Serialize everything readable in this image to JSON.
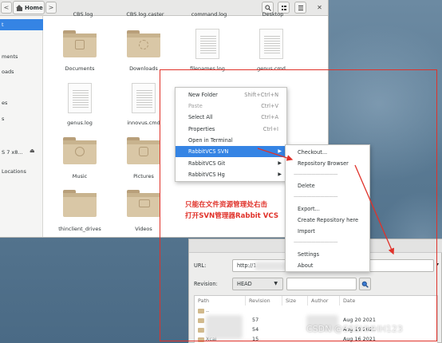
{
  "header": {
    "home_label": "Home",
    "back_glyph": "<",
    "forward_glyph": ">",
    "search_icon": "search-icon",
    "view_icon": "list-view-icon",
    "menu_icon": "hamburger-menu-icon"
  },
  "sidebar": {
    "items": [
      {
        "label": "t",
        "active": true
      },
      {
        "label": "ments"
      },
      {
        "label": "oads"
      },
      {
        "label": "es"
      },
      {
        "label": "s"
      },
      {
        "label": "S 7 x8...",
        "eject": true
      },
      {
        "label": "Locations"
      }
    ]
  },
  "files": {
    "top_row_partial": [
      "CBS.log",
      "CBS.log.caster",
      "command.log",
      "Desktop"
    ],
    "items": [
      {
        "name": "Documents",
        "kind": "folder"
      },
      {
        "name": "Downloads",
        "kind": "folder"
      },
      {
        "name": "filenames.log",
        "kind": "document"
      },
      {
        "name": "genus.cmd",
        "kind": "document"
      },
      {
        "name": "genus.log",
        "kind": "document"
      },
      {
        "name": "innovus.cmd",
        "kind": "document"
      },
      {
        "name": "Music",
        "kind": "folder"
      },
      {
        "name": "Pictures",
        "kind": "folder"
      },
      {
        "name": "thinclient_drives",
        "kind": "folder"
      },
      {
        "name": "Videos",
        "kind": "folder"
      }
    ],
    "partial_suffix": "v"
  },
  "context_menu": {
    "items": [
      {
        "label": "New Folder",
        "accel": "Shift+Ctrl+N"
      },
      {
        "label": "Paste",
        "accel": "Ctrl+V",
        "disabled": true
      },
      {
        "label": "Select All",
        "accel": "Ctrl+A"
      },
      {
        "label": "Properties",
        "accel": "Ctrl+I"
      },
      {
        "label": "Open in Terminal",
        "accel": ""
      },
      {
        "label": "RabbitVCS SVN",
        "accel": "",
        "submenu": true,
        "active": true
      },
      {
        "label": "RabbitVCS Git",
        "accel": "",
        "submenu": true
      },
      {
        "label": "RabbitVCS Hg",
        "accel": "",
        "submenu": true
      }
    ]
  },
  "svn_submenu": {
    "items": [
      "Checkout...",
      "Repository Browser",
      "Delete",
      "Export...",
      "Create Repository here",
      "Import",
      "Settings",
      "About"
    ],
    "separator": "——————————"
  },
  "repo_browser": {
    "url_label": "URL:",
    "url_value": "http://1",
    "revision_label": "Revision:",
    "revision_value": "HEAD",
    "columns": [
      "Path",
      "Revision",
      "Size",
      "Author",
      "Date"
    ],
    "rows": [
      {
        "path": "..",
        "revision": "",
        "size": "",
        "author": "",
        "date": ""
      },
      {
        "path": "",
        "revision": "57",
        "size": "",
        "author": "",
        "date": "Aug 20 2021"
      },
      {
        "path": "",
        "revision": "54",
        "size": "",
        "author": "",
        "date": "Aug 19 2021"
      },
      {
        "path": "Xcai",
        "revision": "15",
        "size": "",
        "author": "",
        "date": "Aug 16 2021"
      }
    ]
  },
  "annotation": {
    "line1": "只能在文件资源管理处右击",
    "line2": "打开SVN管理器Rabbit VCS",
    "color": "#e0322a"
  },
  "watermark": "CSDN @SSSHHHH123",
  "colors": {
    "accent": "#3584e4",
    "annotation_red": "#e0322a",
    "folder": "#d9c7a6"
  }
}
